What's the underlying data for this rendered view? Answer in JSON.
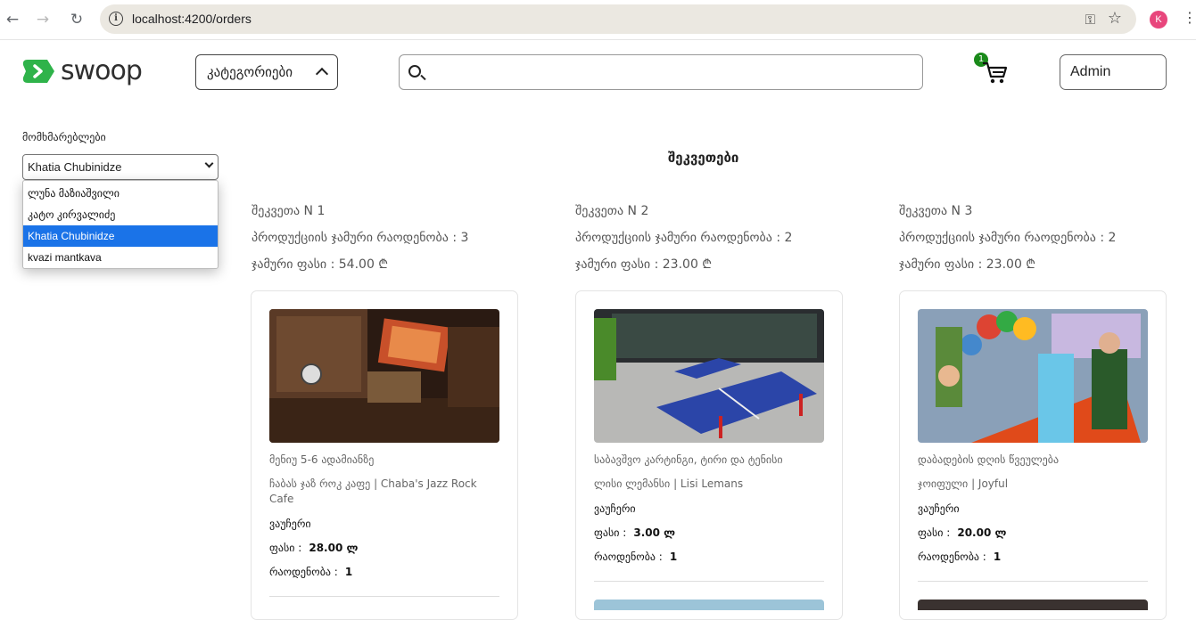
{
  "browser": {
    "url": "localhost:4200/orders",
    "profile_initial": "K"
  },
  "header": {
    "logo_text": "swoop",
    "categories_label": "კატეგორიები",
    "search_placeholder": "",
    "cart_count": "1",
    "admin_label": "Admin"
  },
  "sidebar": {
    "users_label": "მომხმარებლები",
    "selected_user": "Khatia Chubinidze",
    "options": [
      "ლუნა მაზიაშვილი",
      "კატო კირვალიძე",
      "Khatia Chubinidze",
      "kvazi mantkava"
    ]
  },
  "orders": {
    "title": "შეკვეთები",
    "items": [
      {
        "order_label": "შეკვეთა N 1",
        "product_count": "პროდუქციის ჯამური რაოდენობა : 3",
        "total_price": "ჯამური ფასი : 54.00 ₾",
        "card": {
          "subtitle": "მენიუ 5-6 ადამიანზე",
          "name": "ჩაბას ჯაზ როკ კაფე | Chaba's Jazz Rock Cafe",
          "type": "ვაუჩერი",
          "price_label": "ფასი :",
          "price": "28.00 ლ",
          "qty_label": "რაოდენობა :",
          "qty": "1"
        }
      },
      {
        "order_label": "შეკვეთა N 2",
        "product_count": "პროდუქციის ჯამური რაოდენობა : 2",
        "total_price": "ჯამური ფასი : 23.00 ₾",
        "card": {
          "subtitle": "საბავშვო კარტინგი, ტირი და ტენისი",
          "name": "ლისი ლემანსი | Lisi Lemans",
          "type": "ვაუჩერი",
          "price_label": "ფასი :",
          "price": "3.00 ლ",
          "qty_label": "რაოდენობა :",
          "qty": "1"
        }
      },
      {
        "order_label": "შეკვეთა N 3",
        "product_count": "პროდუქციის ჯამური რაოდენობა : 2",
        "total_price": "ჯამური ფასი : 23.00 ₾",
        "card": {
          "subtitle": "დაბადების დღის წვეულება",
          "name": "ჯოიფული | Joyful",
          "type": "ვაუჩერი",
          "price_label": "ფასი :",
          "price": "20.00 ლ",
          "qty_label": "რაოდენობა :",
          "qty": "1"
        }
      }
    ]
  },
  "colors": {
    "brand_green": "#2fb34a",
    "selected_blue": "#1a73e8",
    "badge_green": "#1a8a1a"
  }
}
